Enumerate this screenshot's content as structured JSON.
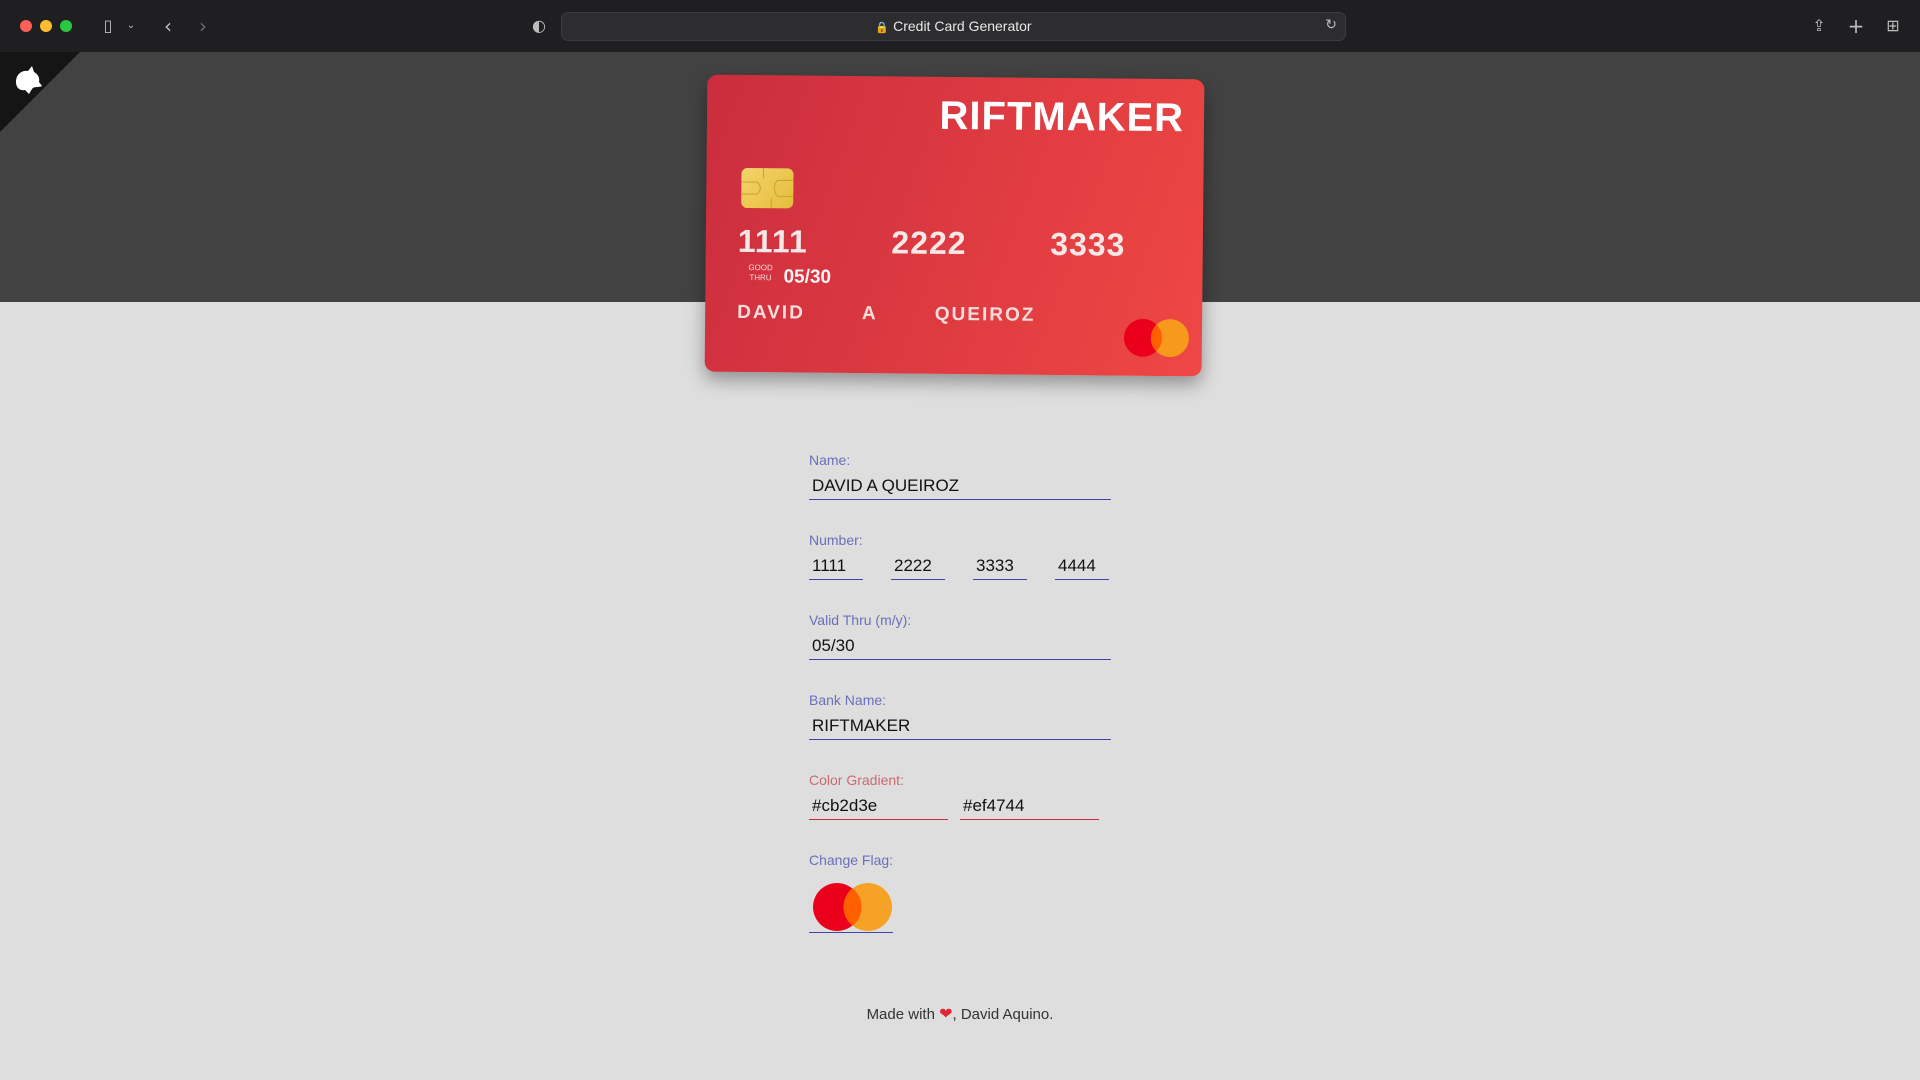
{
  "browser": {
    "url_title": "Credit Card Generator",
    "icons": [
      "sidebar-icon",
      "chevron-down-icon",
      "back-arrow-icon",
      "forward-arrow-icon",
      "shield-icon",
      "lock-icon",
      "reload-icon",
      "share-icon",
      "plus-icon",
      "tabs-grid-icon"
    ]
  },
  "card": {
    "bank_name": "RIFTMAKER",
    "number": "1111   2222   3333   4444",
    "good_thru_label": "GOOD\nTHRU",
    "expiry": "05/30",
    "holder": "DAVID   A   QUEIROZ",
    "gradient_start": "#cb2d3e",
    "gradient_end": "#ef4744",
    "flag": "mastercard"
  },
  "form": {
    "name_label": "Name:",
    "name_value": "DAVID A QUEIROZ",
    "number_label": "Number:",
    "number_parts": [
      "1111",
      "2222",
      "3333",
      "4444"
    ],
    "valid_thru_label": "Valid Thru (m/y):",
    "valid_thru_value": "05/30",
    "bank_name_label": "Bank Name:",
    "bank_name_value": "RIFTMAKER",
    "color_gradient_label": "Color Gradient:",
    "color_start_value": "#cb2d3e",
    "color_end_value": "#ef4744",
    "change_flag_label": "Change Flag:"
  },
  "footer": {
    "prefix": "Made with ",
    "suffix": ", David Aquino."
  },
  "colors": {
    "hero_band": "#424242",
    "page_bg": "#dedede",
    "accent_blue": "#4146a8",
    "mastercard_red": "#eb001b",
    "mastercard_orange": "#f79e1b"
  }
}
